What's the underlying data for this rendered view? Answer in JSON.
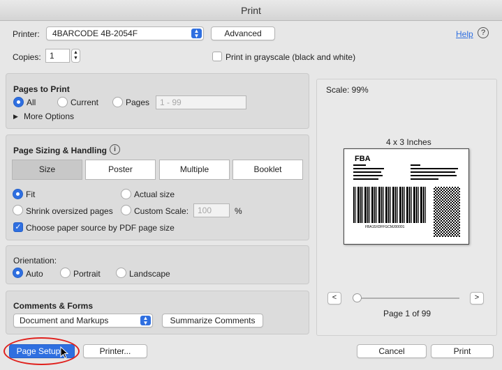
{
  "window": {
    "title": "Print"
  },
  "printer": {
    "label": "Printer:",
    "value": "4BARCODE 4B-2054F",
    "advanced_label": "Advanced",
    "help_label": "Help"
  },
  "copies": {
    "label": "Copies:",
    "value": "1"
  },
  "grayscale": {
    "label": "Print in grayscale (black and white)",
    "checked": false
  },
  "pages": {
    "title": "Pages to Print",
    "all_label": "All",
    "current_label": "Current",
    "pages_label": "Pages",
    "range_placeholder": "1 - 99",
    "more_options_label": "More Options",
    "selected": "All"
  },
  "sizing": {
    "title": "Page Sizing & Handling",
    "tabs": [
      "Size",
      "Poster",
      "Multiple",
      "Booklet"
    ],
    "selected_tab": "Size",
    "fit_label": "Fit",
    "actual_label": "Actual size",
    "shrink_label": "Shrink oversized pages",
    "custom_label": "Custom Scale:",
    "custom_value": "100",
    "percent_label": "%",
    "paper_source_label": "Choose paper source by PDF page size",
    "paper_source_checked": true
  },
  "orientation": {
    "title": "Orientation:",
    "auto_label": "Auto",
    "portrait_label": "Portrait",
    "landscape_label": "Landscape",
    "selected": "Auto"
  },
  "comments": {
    "title": "Comments & Forms",
    "value": "Document and Markups",
    "summarize_label": "Summarize Comments"
  },
  "preview": {
    "scale_label": "Scale: 99%",
    "size_label": "4 x 3 Inches",
    "label_title": "FBA",
    "barcode_text": "FBA15XDFFGCMJ00001",
    "page_label": "Page 1 of 99",
    "prev_icon": "<",
    "next_icon": ">"
  },
  "footer": {
    "page_setup_label": "Page Setup...",
    "printer_label": "Printer...",
    "cancel_label": "Cancel",
    "print_label": "Print"
  },
  "colors": {
    "accent": "#2f6fe0",
    "highlight_ring": "#e0201c"
  }
}
